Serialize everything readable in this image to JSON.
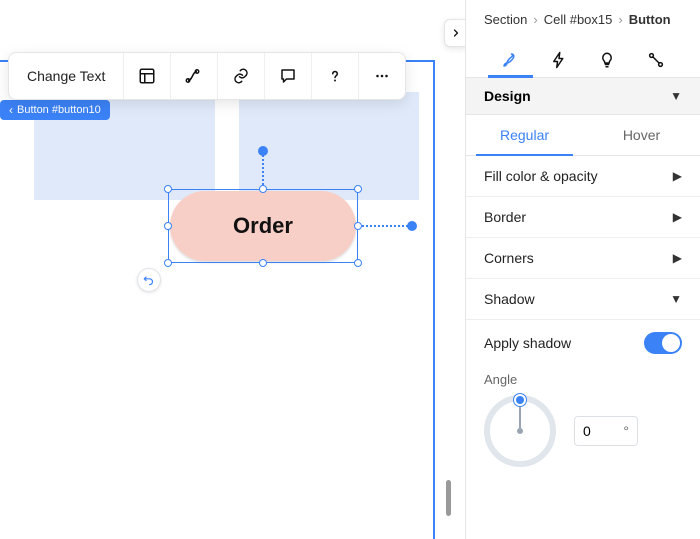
{
  "breadcrumb": {
    "section": "Section",
    "cell": "Cell #box15",
    "current": "Button"
  },
  "toolbar": {
    "change_text": "Change Text"
  },
  "tag": {
    "label": "Button #button10"
  },
  "canvas_button": {
    "label": "Order"
  },
  "design": {
    "title": "Design",
    "tabs": {
      "regular": "Regular",
      "hover": "Hover",
      "active": "regular"
    },
    "rows": {
      "fill": "Fill color & opacity",
      "border": "Border",
      "corners": "Corners",
      "shadow": "Shadow",
      "apply_shadow": "Apply shadow"
    },
    "shadow": {
      "applied": true,
      "angle_label": "Angle",
      "angle_value": "0",
      "angle_unit": "°"
    }
  }
}
